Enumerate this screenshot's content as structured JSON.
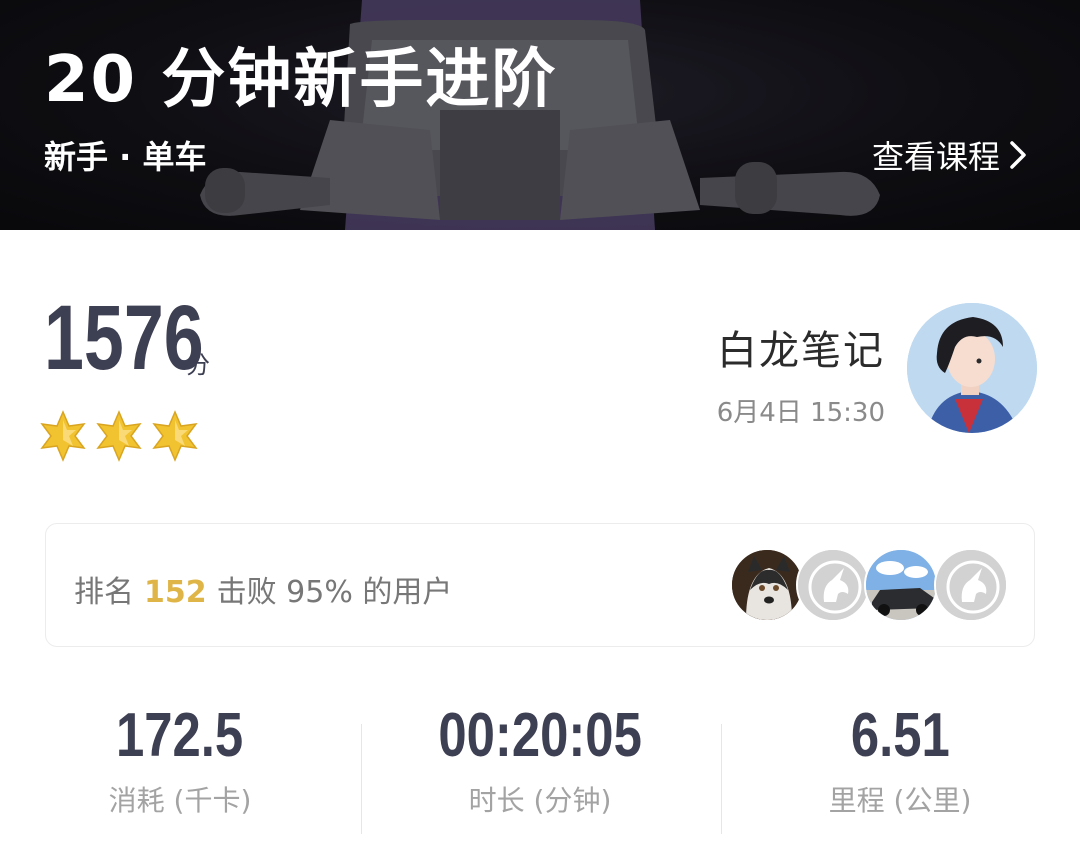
{
  "hero": {
    "title": "20 分钟新手进阶",
    "subtitle": "新手 · 单车",
    "view_course_label": "查看课程"
  },
  "score": {
    "value": "1576",
    "unit": "分",
    "stars_filled": 3
  },
  "user": {
    "name": "白龙笔记",
    "datetime": "6月4日 15:30"
  },
  "rank": {
    "prefix": "排名",
    "number": "152",
    "suffix": "击败 95% 的用户",
    "avatar_count": 4
  },
  "stats": [
    {
      "value": "172.5",
      "label": "消耗 (千卡)"
    },
    {
      "value": "00:20:05",
      "label": "时长 (分钟)"
    },
    {
      "value": "6.51",
      "label": "里程 (公里)"
    }
  ],
  "colors": {
    "score_text": "#3d3f52",
    "rank_highlight": "#e0b548",
    "star_gold": "#f2c330",
    "label_gray": "#a3a3a3",
    "hero_bg": "#17161d"
  }
}
